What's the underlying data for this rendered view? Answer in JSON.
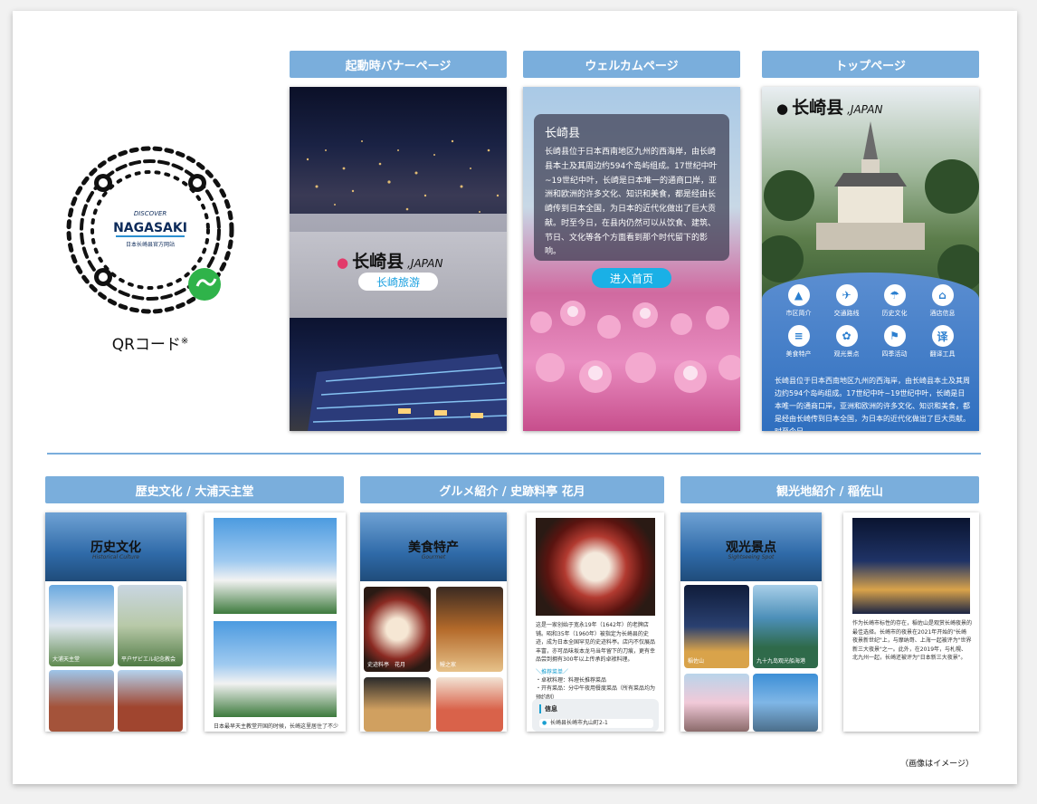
{
  "qr": {
    "caption": "QRコード",
    "mark": "※",
    "badge_top": "DISCOVER",
    "badge_main": "NAGASAKI",
    "badge_sub": "日本长崎县官方网站"
  },
  "headers": {
    "banner": "起動時バナーページ",
    "welcome": "ウェルカムページ",
    "top": "トップページ",
    "history": "歴史文化 / 大浦天主堂",
    "gourmet": "グルメ紹介 / 史跡料亭 花月",
    "sightseeing": "観光地紹介 / 稲佐山"
  },
  "banner": {
    "logo": "长崎县",
    "logo_suffix": ",JAPAN",
    "button": "长崎旅游"
  },
  "welcome": {
    "title": "长崎县",
    "body": "长崎县位于日本西南地区九州的西海岸，由长崎县本土及其周边约594个岛屿组成。17世纪中叶~19世纪中叶，长崎是日本唯一的通商口岸，亚洲和欧洲的许多文化、知识和美食，都是经由长崎传到日本全国，为日本的近代化做出了巨大贡献。时至今日，在县内仍然可以从饮食、建筑、节日、文化等各个方面看到那个时代留下的影响。",
    "button": "进入首页"
  },
  "top": {
    "logo": "长崎县",
    "logo_suffix": ",JAPAN",
    "icons": [
      {
        "label": "市区简介",
        "icon": "mountain-icon",
        "glyph": "▲"
      },
      {
        "label": "交通路线",
        "icon": "plane-icon",
        "glyph": "✈"
      },
      {
        "label": "历史文化",
        "icon": "umbrella-icon",
        "glyph": "☂"
      },
      {
        "label": "酒店信息",
        "icon": "hotel-icon",
        "glyph": "⌂"
      },
      {
        "label": "美食特产",
        "icon": "food-icon",
        "glyph": "≡"
      },
      {
        "label": "观光景点",
        "icon": "spot-icon",
        "glyph": "✿"
      },
      {
        "label": "四季活动",
        "icon": "flag-icon",
        "glyph": "⚑"
      },
      {
        "label": "翻译工具",
        "icon": "translate-icon",
        "glyph": "译"
      }
    ],
    "body": "长崎县位于日本西南地区九州的西海岸，由长崎县本土及其周边约594个岛屿组成。17世纪中叶~19世纪中叶，长崎是日本唯一的通商口岸，亚洲和欧洲的许多文化、知识和美食，都是经由长崎传到日本全国，为日本的近代化做出了巨大贡献。时至今日，"
  },
  "history": {
    "title": "历史文化",
    "subtitle": "Historical Culture",
    "tiles": [
      "大浦天主堂",
      "平户ザビエル纪念教会",
      "",
      ""
    ],
    "body": "日本最早天主教堂开国的时候，长崎这里居住了不少外国"
  },
  "gourmet": {
    "title": "美食特产",
    "subtitle": "Gourmet",
    "tiles": [
      "史迹料亭　花月",
      "鳗之家",
      "",
      ""
    ],
    "body": "这是一家创始于宽永19年（1642年）的老牌店铺。昭和35年（1960年）被指定为长崎县的史迹，成为日本全国罕见的史迹料亭。店内不仅展品丰富，亦可品味坂本龙马当年留下的刀痕，更有幸品尝到拥有300年以上传承的卓袱料理。",
    "tag_title": "＼推荐菜单／",
    "tags": [
      "・卓袱料理：料理长推荐菜品",
      "・开有菜品：分中午夜用餐度菜品（所有菜品均为预约制）"
    ],
    "info_title": "信息",
    "address": "长崎县长崎市丸山町2-1"
  },
  "sightseeing": {
    "title": "观光景点",
    "subtitle": "Sightseeing Spot",
    "tiles": [
      "稲佐山",
      "九十九岛观光船海港",
      "",
      ""
    ],
    "body": "作为长崎市标性的存在，稲佐山是观赏长崎夜景的最佳选择。长崎市的夜景在2021年开始的\"长崎夜景新世纪\"上，与摩纳哥、上海一起被评为\"世界新三大夜景\"之一。此外，在2019年，与札幌、北九州一起，长崎还被评为\"日本新三大夜景\"。"
  },
  "footer_note": "（画像はイメージ）"
}
